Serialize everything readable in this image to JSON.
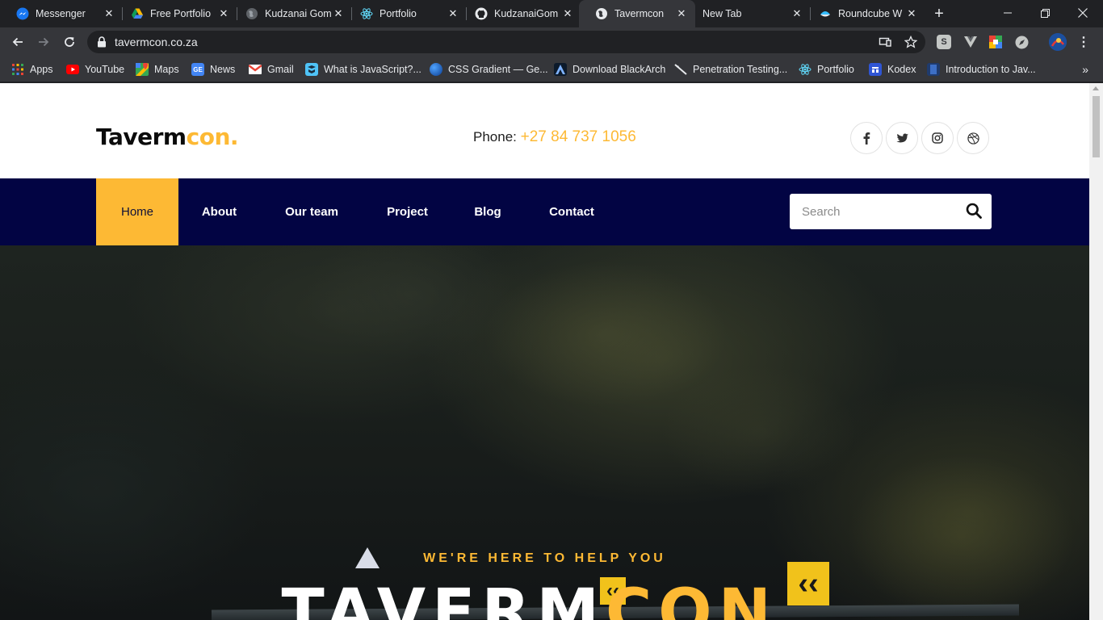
{
  "browser": {
    "tabs": [
      {
        "title": "Messenger",
        "icon": "messenger-icon",
        "active": false
      },
      {
        "title": "Free Portfolio",
        "icon": "google-drive-icon",
        "active": false
      },
      {
        "title": "Kudzanai Gom",
        "icon": "globe-icon",
        "active": false
      },
      {
        "title": "Portfolio",
        "icon": "react-icon",
        "active": false
      },
      {
        "title": "KudzanaiGom",
        "icon": "github-icon",
        "active": false
      },
      {
        "title": "Tavermcon",
        "icon": "globe-icon",
        "active": true
      },
      {
        "title": "New Tab",
        "icon": "",
        "active": false
      },
      {
        "title": "Roundcube W",
        "icon": "roundcube-icon",
        "active": false
      }
    ],
    "url": "tavermcon.co.za",
    "bookmarks": [
      {
        "label": "Apps",
        "icon": "apps-grid-icon"
      },
      {
        "label": "YouTube",
        "icon": "youtube-icon"
      },
      {
        "label": "Maps",
        "icon": "maps-icon"
      },
      {
        "label": "News",
        "icon": "google-news-icon"
      },
      {
        "label": "Gmail",
        "icon": "gmail-icon"
      },
      {
        "label": "What is JavaScript?...",
        "icon": "js-icon"
      },
      {
        "label": "CSS Gradient — Ge...",
        "icon": "css-gradient-icon"
      },
      {
        "label": "Download BlackArch",
        "icon": "blackarch-icon"
      },
      {
        "label": "Penetration Testing...",
        "icon": "pentest-icon"
      },
      {
        "label": "Portfolio",
        "icon": "react-icon"
      },
      {
        "label": "Kodex",
        "icon": "kodex-icon"
      },
      {
        "label": "Introduction to Jav...",
        "icon": "doc-icon"
      }
    ]
  },
  "site": {
    "logo_main": "Taverm",
    "logo_accent": "con.",
    "phone_label": "Phone:",
    "phone_number": "+27 84 737 1056",
    "social": [
      "facebook-icon",
      "twitter-icon",
      "instagram-icon",
      "dribbble-icon"
    ],
    "nav": [
      {
        "label": "Home",
        "active": true
      },
      {
        "label": "About",
        "active": false
      },
      {
        "label": "Our team",
        "active": false
      },
      {
        "label": "Project",
        "active": false
      },
      {
        "label": "Blog",
        "active": false
      },
      {
        "label": "Contact",
        "active": false
      }
    ],
    "search_placeholder": "Search",
    "hero_kicker": "WE'RE HERE TO HELP YOU",
    "hero_title_main": "TAVERM",
    "hero_title_accent": "CON."
  },
  "colors": {
    "accent": "#fdb934",
    "nav_bg": "#020443",
    "chrome_dark": "#202124",
    "chrome_toolbar": "#35363a"
  }
}
